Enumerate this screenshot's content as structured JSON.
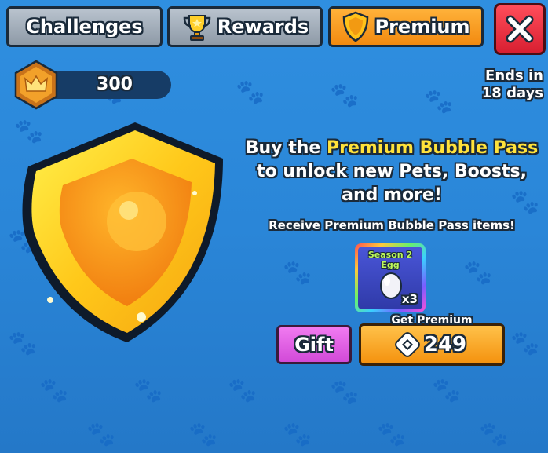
{
  "tabs": {
    "challenges": "Challenges",
    "rewards": "Rewards",
    "premium": "Premium"
  },
  "currency": {
    "value": "300",
    "icon": "crown-icon"
  },
  "timer": {
    "line1": "Ends in",
    "line2": "18 days"
  },
  "pitch": {
    "buy_the": "Buy the",
    "pass_name": "Premium Bubble Pass",
    "line2": "to unlock new Pets, Boosts,",
    "line3": "and more!",
    "subtext": "Receive Premium Bubble Pass items!"
  },
  "reward_item": {
    "name_line1": "Season 2",
    "name_line2": "Egg",
    "quantity": "x3",
    "icon": "egg-icon"
  },
  "actions": {
    "gift_label": "Gift",
    "get_premium_label": "Get Premium",
    "price": "249",
    "price_icon": "robux-icon"
  },
  "colors": {
    "background": "#2a86d8",
    "highlight_text": "#ffe23a",
    "active_tab": "#f28a10",
    "close_button": "#d81f31",
    "gift_button": "#d24ad8"
  }
}
